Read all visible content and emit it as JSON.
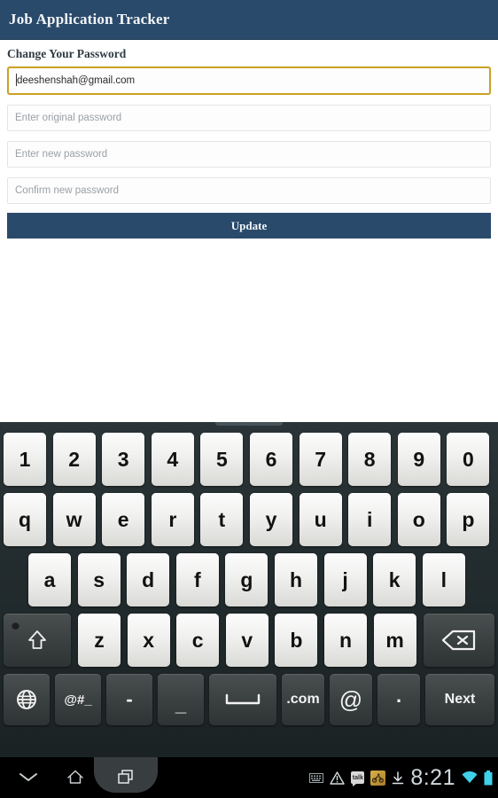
{
  "app": {
    "title": "Job Application Tracker",
    "header_color": "#2a4a6b"
  },
  "content": {
    "section_title": "Change Your Password",
    "fields": [
      {
        "name": "email",
        "value": "deeshenshah@gmail.com",
        "placeholder": "",
        "focused": true
      },
      {
        "name": "original-password",
        "value": "",
        "placeholder": "Enter original password",
        "focused": false
      },
      {
        "name": "new-password",
        "value": "",
        "placeholder": "Enter new password",
        "focused": false
      },
      {
        "name": "confirm-password",
        "value": "",
        "placeholder": "Confirm new password",
        "focused": false
      }
    ],
    "update_label": "Update"
  },
  "keyboard": {
    "row_numbers": [
      "1",
      "2",
      "3",
      "4",
      "5",
      "6",
      "7",
      "8",
      "9",
      "0"
    ],
    "row_top": [
      "q",
      "w",
      "e",
      "r",
      "t",
      "y",
      "u",
      "i",
      "o",
      "p"
    ],
    "row_home": [
      "a",
      "s",
      "d",
      "f",
      "g",
      "h",
      "j",
      "k",
      "l"
    ],
    "row_bottom": [
      "z",
      "x",
      "c",
      "v",
      "b",
      "n",
      "m"
    ],
    "shift_label": "⇧",
    "backspace_label": "⌫",
    "func_keys": [
      {
        "name": "language-globe",
        "label": "⊕"
      },
      {
        "name": "symbols",
        "label": "@#_"
      },
      {
        "name": "hyphen",
        "label": "-"
      },
      {
        "name": "underscore",
        "label": "_"
      },
      {
        "name": "space",
        "label": ""
      },
      {
        "name": "dot-com",
        "label": ".com"
      },
      {
        "name": "at-sign",
        "label": "@"
      },
      {
        "name": "period",
        "label": "."
      },
      {
        "name": "next",
        "label": "Next"
      }
    ]
  },
  "navbar": {
    "back_label": "back",
    "home_label": "home",
    "recents_label": "recent apps",
    "clock": "8:21",
    "status_icons": [
      "keyboard-icon",
      "warning-icon",
      "talk-icon",
      "game-icon",
      "download-icon",
      "wifi-icon",
      "battery-icon"
    ],
    "talk_text": "talk"
  }
}
